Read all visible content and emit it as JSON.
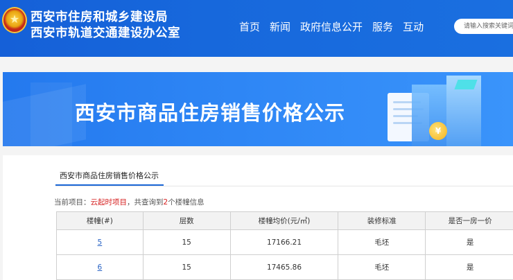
{
  "header": {
    "org_line1": "西安市住房和城乡建设局",
    "org_line2": "西安市轨道交通建设办公室",
    "nav": [
      "首页",
      "新闻",
      "政府信息公开",
      "服务",
      "互动"
    ],
    "search_placeholder": "请输入搜索关键词"
  },
  "banner": {
    "title": "西安市商品住房销售价格公示",
    "coin_symbol": "¥"
  },
  "tab": {
    "label": "西安市商品住房销售价格公示"
  },
  "info": {
    "prefix": "当前项目：",
    "project": "云起时项目",
    "middle": "，共查询到",
    "count": "2",
    "suffix": "个楼幢信息"
  },
  "table": {
    "headers": [
      "楼幢(#)",
      "层数",
      "楼幢均价(元/㎡)",
      "装修标准",
      "是否一房一价"
    ],
    "rows": [
      [
        "5",
        "15",
        "17166.21",
        "毛坯",
        "是"
      ],
      [
        "6",
        "15",
        "17465.86",
        "毛坯",
        "是"
      ]
    ]
  },
  "colors": {
    "header_bg": "#1560d8",
    "banner_bg": "#2e86f5",
    "accent": "#1a66d6",
    "highlight": "#d62020",
    "link": "#2a64c5"
  }
}
